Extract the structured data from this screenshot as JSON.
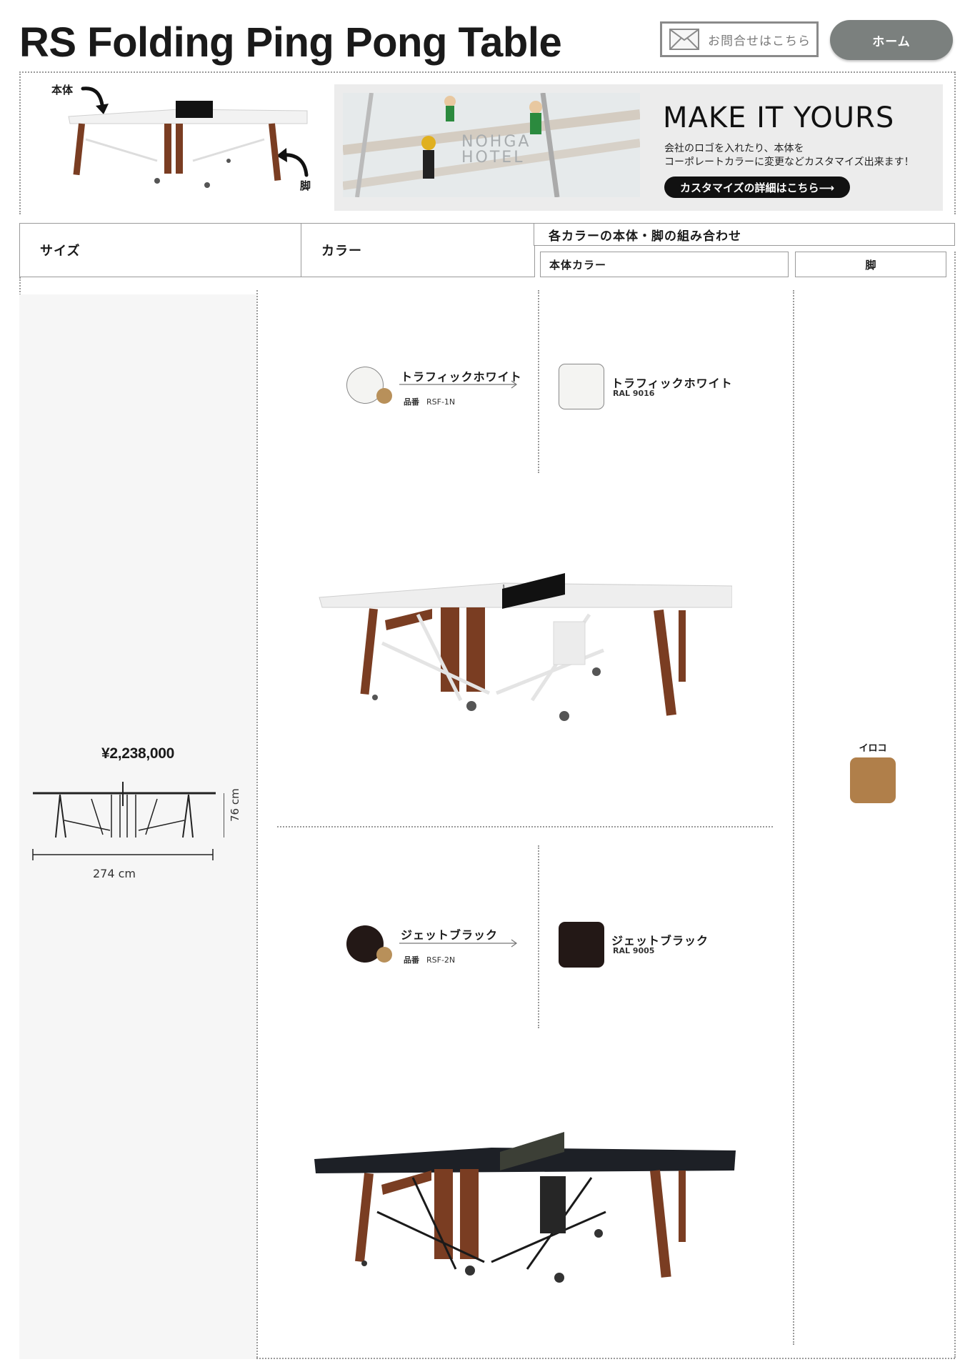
{
  "header": {
    "title": "RS Folding Ping Pong Table",
    "contact_label": "お問合せはこちら",
    "home_label": "ホーム"
  },
  "diagram": {
    "body_label": "本体",
    "leg_label": "脚"
  },
  "banner": {
    "photo_sign_line1": "NOHGA",
    "photo_sign_line2": "HOTEL",
    "headline": "MAKE IT YOURS",
    "line1": "会社のロゴを入れたり、本体を",
    "line2": "コーポレートカラーに変更などカスタマイズ出来ます！",
    "cta": "カスタマイズの詳細はこちら⟶"
  },
  "table_header": {
    "size": "サイズ",
    "color": "カラー",
    "combo": "各カラーの本体・脚の組み合わせ",
    "body_color": "本体カラー",
    "leg": "脚"
  },
  "size": {
    "price": "¥2,238,000",
    "width": "274 cm",
    "height": "76 cm"
  },
  "variants": [
    {
      "color_name": "トラフィックホワイト",
      "part_no_label": "品番",
      "part_no": "RSF-1N",
      "body_name": "トラフィックホワイト",
      "ral": "RAL 9016",
      "body_hex": "#f4f4f2",
      "dot_hex": "#b8905a"
    },
    {
      "color_name": "ジェットブラック",
      "part_no_label": "品番",
      "part_no": "RSF-2N",
      "body_name": "ジェットブラック",
      "ral": "RAL 9005",
      "body_hex": "#231816",
      "dot_hex": "#b8905a"
    }
  ],
  "leg": {
    "name": "イロコ",
    "hex": "#b07f4a"
  },
  "colors": {
    "wood": "#7a3d22",
    "home_button": "#7b807e"
  }
}
